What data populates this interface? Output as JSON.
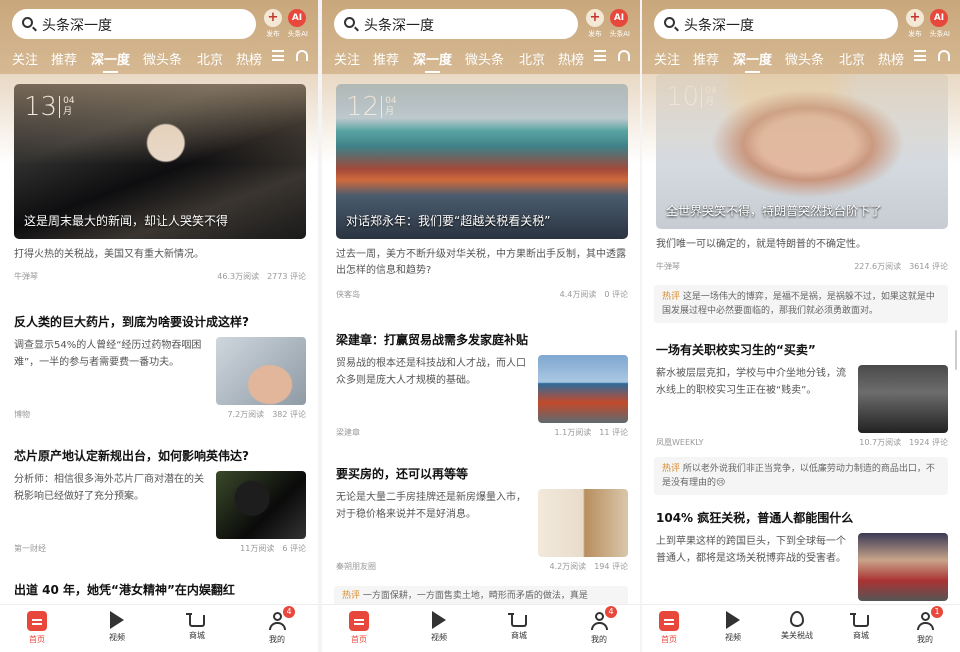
{
  "header": {
    "search_text": "头条深一度",
    "publish_label": "发布",
    "ai_label": "头条AI",
    "ai_badge": "AI",
    "plus": "+"
  },
  "tabs": [
    "关注",
    "推荐",
    "深一度",
    "微头条",
    "北京",
    "热榜"
  ],
  "nav": {
    "home": "首页",
    "video": "视频",
    "mall": "商城",
    "me": "我的",
    "tariff": "美关税战",
    "badge": "4",
    "badge3": "1"
  },
  "screens": [
    {
      "hero": {
        "day": "13",
        "month": "04",
        "month_unit": "月",
        "caption": "这是周末最大的新闻，却让人哭笑不得"
      },
      "hero_desc": "打得火热的关税战，美国又有重大新情况。",
      "hero_meta": {
        "source": "牛弹琴",
        "reads": "46.3万阅读",
        "comments": "2773 评论"
      },
      "articles": [
        {
          "title": "反人类的巨大药片，到底为啥要设计成这样?",
          "desc": "调查显示54%的人曾经“经历过药物吞咽困难”，一半的参与者需要费一番功夫。",
          "source": "博物",
          "reads": "7.2万阅读",
          "comments": "382 评论"
        },
        {
          "title": "芯片原产地认定新规出台，如何影响英伟达?",
          "desc": "分析师：相信很多海外芯片厂商对潜在的关税影响已经做好了充分预案。",
          "source": "第一财经",
          "reads": "11万阅读",
          "comments": "6 评论"
        },
        {
          "title": "出道 40 年，她凭“港女精神”在内娱翻红"
        }
      ]
    },
    {
      "hero": {
        "day": "12",
        "month": "04",
        "month_unit": "月",
        "caption": "对话郑永年：我们要“超越关税看关税”"
      },
      "hero_desc": "过去一周，美方不断升级对华关税，中方果断出手反制，其中透露出怎样的信息和趋势?",
      "hero_meta": {
        "source": "侠客岛",
        "reads": "4.4万阅读",
        "comments": "0 评论"
      },
      "articles": [
        {
          "title": "梁建章：打赢贸易战需多发家庭补贴",
          "desc": "贸易战的根本还是科技战和人才战，而人口众多则是庞大人才规模的基础。",
          "source": "梁建章",
          "reads": "1.1万阅读",
          "comments": "11 评论"
        },
        {
          "title": "要买房的，还可以再等等",
          "desc": "无论是大量二手房挂牌还是新房爆量入市，对于稳价格来说并不是好消息。",
          "source": "秦朔朋友圈",
          "reads": "4.2万阅读",
          "comments": "194 评论"
        }
      ],
      "hot": {
        "label": "热评",
        "text": "一方面保耕，一方面售卖土地，畸形而矛盾的做法，真是"
      }
    },
    {
      "hero": {
        "day": "10",
        "month": "04",
        "month_unit": "月",
        "caption": "全世界哭笑不得，特朗普突然找台阶下了"
      },
      "hero_desc": "我们唯一可以确定的，就是特朗普的不确定性。",
      "hero_meta": {
        "source": "牛弹琴",
        "reads": "227.6万阅读",
        "comments": "3614 评论"
      },
      "hot1": {
        "label": "热评",
        "text": "这是一场伟大的博弈，是福不是祸，是祸躲不过，如果这就是中国发展过程中必然要面临的，那我们就必须勇敢面对。"
      },
      "articles": [
        {
          "title": "一场有关职校实习生的“买卖”",
          "desc": "薪水被层层克扣，学校与中介坐地分钱，流水线上的职校实习生正在被“贱卖”。",
          "source": "凤凰WEEKLY",
          "reads": "10.7万阅读",
          "comments": "1924 评论"
        },
        {
          "title": "104% 疯狂关税，普通人都能围什么",
          "desc": "上到苹果这样的跨国巨头，下到全球每一个普通人，都将是这场关税博弈战的受害者。"
        }
      ],
      "hot2": {
        "label": "热评",
        "text": "所以老外说我们非正当竞争，以低廉劳动力制造的商品出口，不是没有理由的😢"
      }
    }
  ]
}
